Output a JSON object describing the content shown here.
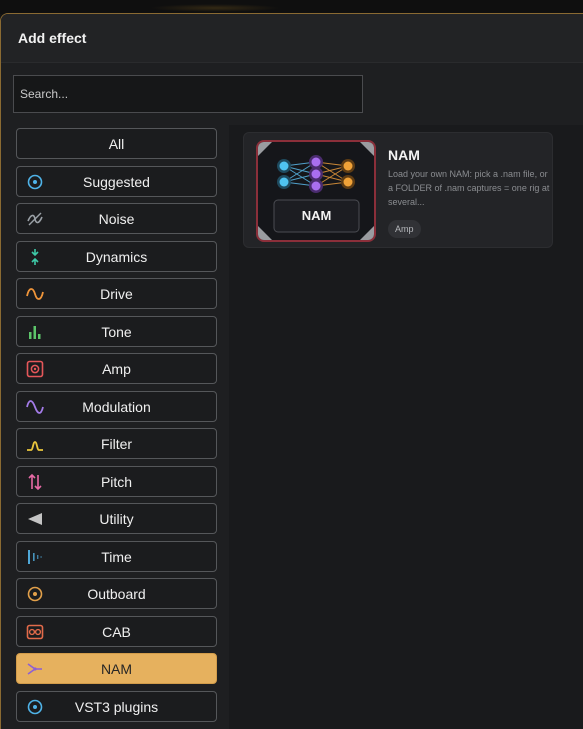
{
  "dialog": {
    "title": "Add effect"
  },
  "search": {
    "placeholder": "Search..."
  },
  "categories": [
    {
      "label": "All",
      "icon": "none"
    },
    {
      "label": "Suggested",
      "icon": "target-icon",
      "color": "#4fb3e8"
    },
    {
      "label": "Noise",
      "icon": "noise-gate-icon",
      "color": "#9aa0a6"
    },
    {
      "label": "Dynamics",
      "icon": "dynamics-arrows-icon",
      "color": "#3ec9a7"
    },
    {
      "label": "Drive",
      "icon": "drive-wave-icon",
      "color": "#f0953a"
    },
    {
      "label": "Tone",
      "icon": "eq-bars-icon",
      "color": "#5cc56a"
    },
    {
      "label": "Amp",
      "icon": "amp-speaker-icon",
      "color": "#e5575a"
    },
    {
      "label": "Modulation",
      "icon": "sine-wave-icon",
      "color": "#a37be8"
    },
    {
      "label": "Filter",
      "icon": "filter-curve-icon",
      "color": "#e9c53c"
    },
    {
      "label": "Pitch",
      "icon": "pitch-arrows-icon",
      "color": "#e86aa6"
    },
    {
      "label": "Utility",
      "icon": "triangle-left-icon",
      "color": "#c4c4c4"
    },
    {
      "label": "Time",
      "icon": "time-bars-icon",
      "color": "#4fa8d8"
    },
    {
      "label": "Outboard",
      "icon": "knob-icon",
      "color": "#e2a04a"
    },
    {
      "label": "CAB",
      "icon": "cab-speaker-icon",
      "color": "#e26a4a"
    },
    {
      "label": "NAM",
      "icon": "nam-network-icon",
      "color": "#8c5fd6",
      "active": true
    },
    {
      "label": "VST3 plugins",
      "icon": "plugin-target-icon",
      "color": "#4fb3e8"
    }
  ],
  "results": [
    {
      "thumb_label": "NAM",
      "title": "NAM",
      "description": "Load your own NAM: pick a .nam file, or a FOLDER of .nam captures = one rig at several...",
      "tag": "Amp"
    }
  ]
}
